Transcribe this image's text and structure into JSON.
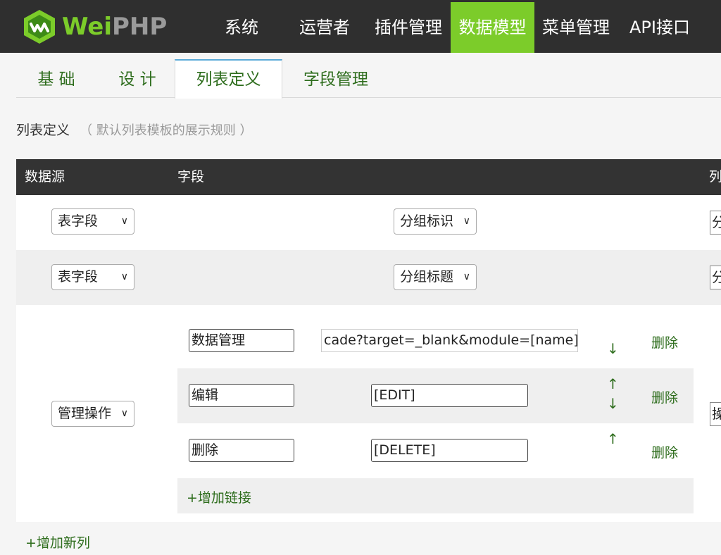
{
  "logo": {
    "wei": "Wei",
    "php": "PHP"
  },
  "nav": [
    {
      "label": "系统"
    },
    {
      "label": "运营者"
    },
    {
      "label": "插件管理"
    },
    {
      "label": "数据模型",
      "active": true
    },
    {
      "label": "菜单管理"
    },
    {
      "label": "API接口"
    }
  ],
  "tabs": [
    {
      "label": "基 础"
    },
    {
      "label": "设 计"
    },
    {
      "label": "列表定义",
      "active": true
    },
    {
      "label": "字段管理"
    }
  ],
  "section": {
    "title": "列表定义",
    "hint": "（ 默认列表模板的展示规则 ）"
  },
  "table": {
    "headers": [
      "数据源",
      "字段",
      "列"
    ],
    "rows": [
      {
        "source": "表字段",
        "field": "分组标识",
        "col_clip": "分"
      },
      {
        "source": "表字段",
        "field": "分组标题",
        "col_clip": "分"
      },
      {
        "source": "管理操作",
        "col_clip": "操",
        "links": [
          {
            "name": "数据管理",
            "url": "cade?target=_blank&module=[name]",
            "up": "",
            "down": "↓",
            "delete": "删除"
          },
          {
            "name": "编辑",
            "url": "[EDIT]",
            "up": "↑",
            "down": "↓",
            "delete": "删除"
          },
          {
            "name": "删除",
            "url": "[DELETE]",
            "up": "↑",
            "down": "",
            "delete": "删除"
          }
        ],
        "add_link": "+增加链接"
      }
    ]
  },
  "add_column": "+增加新列",
  "colors": {
    "topbar": "#2f2f2f",
    "accent": "#7ccc2a",
    "link": "#2e6d1d",
    "tab_top": "#5aaad8"
  }
}
